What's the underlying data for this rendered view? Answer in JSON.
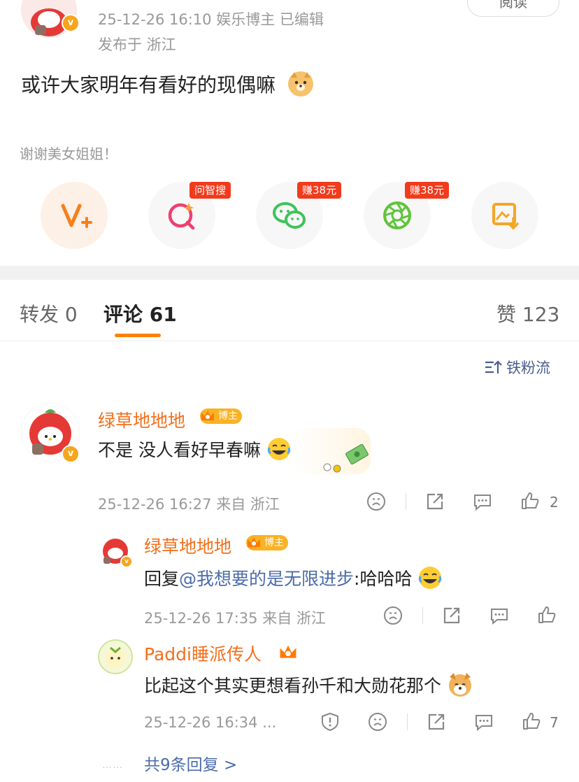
{
  "post": {
    "time_category": "25-12-26 16:10  娱乐博主  已编辑",
    "location": "发布于 浙江",
    "follow_label": "阅读",
    "text": "或许大家明年有看好的现偶嘛",
    "thanks": "谢谢美女姐姐！",
    "avatar_badge": "v"
  },
  "share": {
    "tags": [
      "问智搜",
      "赚38元",
      "赚38元"
    ],
    "icons": [
      "v-plus-icon",
      "zhisou-icon",
      "wechat-icon",
      "moments-icon",
      "save-image-icon"
    ]
  },
  "tabs": {
    "repost": "转发 0",
    "comments": "评论 61",
    "likes": "赞 123"
  },
  "sort": {
    "label": "铁粉流"
  },
  "comments": [
    {
      "nick": "绿草地地地",
      "badge": "博主",
      "text": "不是 没人看好早春嘛",
      "meta": "25-12-26 16:27  来自 浙江",
      "likes": "2"
    },
    {
      "nick": "绿草地地地",
      "badge": "博主",
      "reply_prefix": "回复",
      "mention": "@我想要的是无限进步",
      "text_after": ":哈哈哈",
      "meta": "25-12-26 17:35  来自 浙江",
      "likes": ""
    },
    {
      "nick": "Paddi睡派传人",
      "text": "比起这个其实更想看孙千和大勋花那个",
      "meta": "25-12-26 16:34 ...",
      "likes": "7"
    }
  ],
  "more_replies": "共9条回复 >",
  "dots": "……",
  "colors": {
    "accent": "#ff8200",
    "nick": "#f46f1b",
    "link": "#4b6caa"
  }
}
